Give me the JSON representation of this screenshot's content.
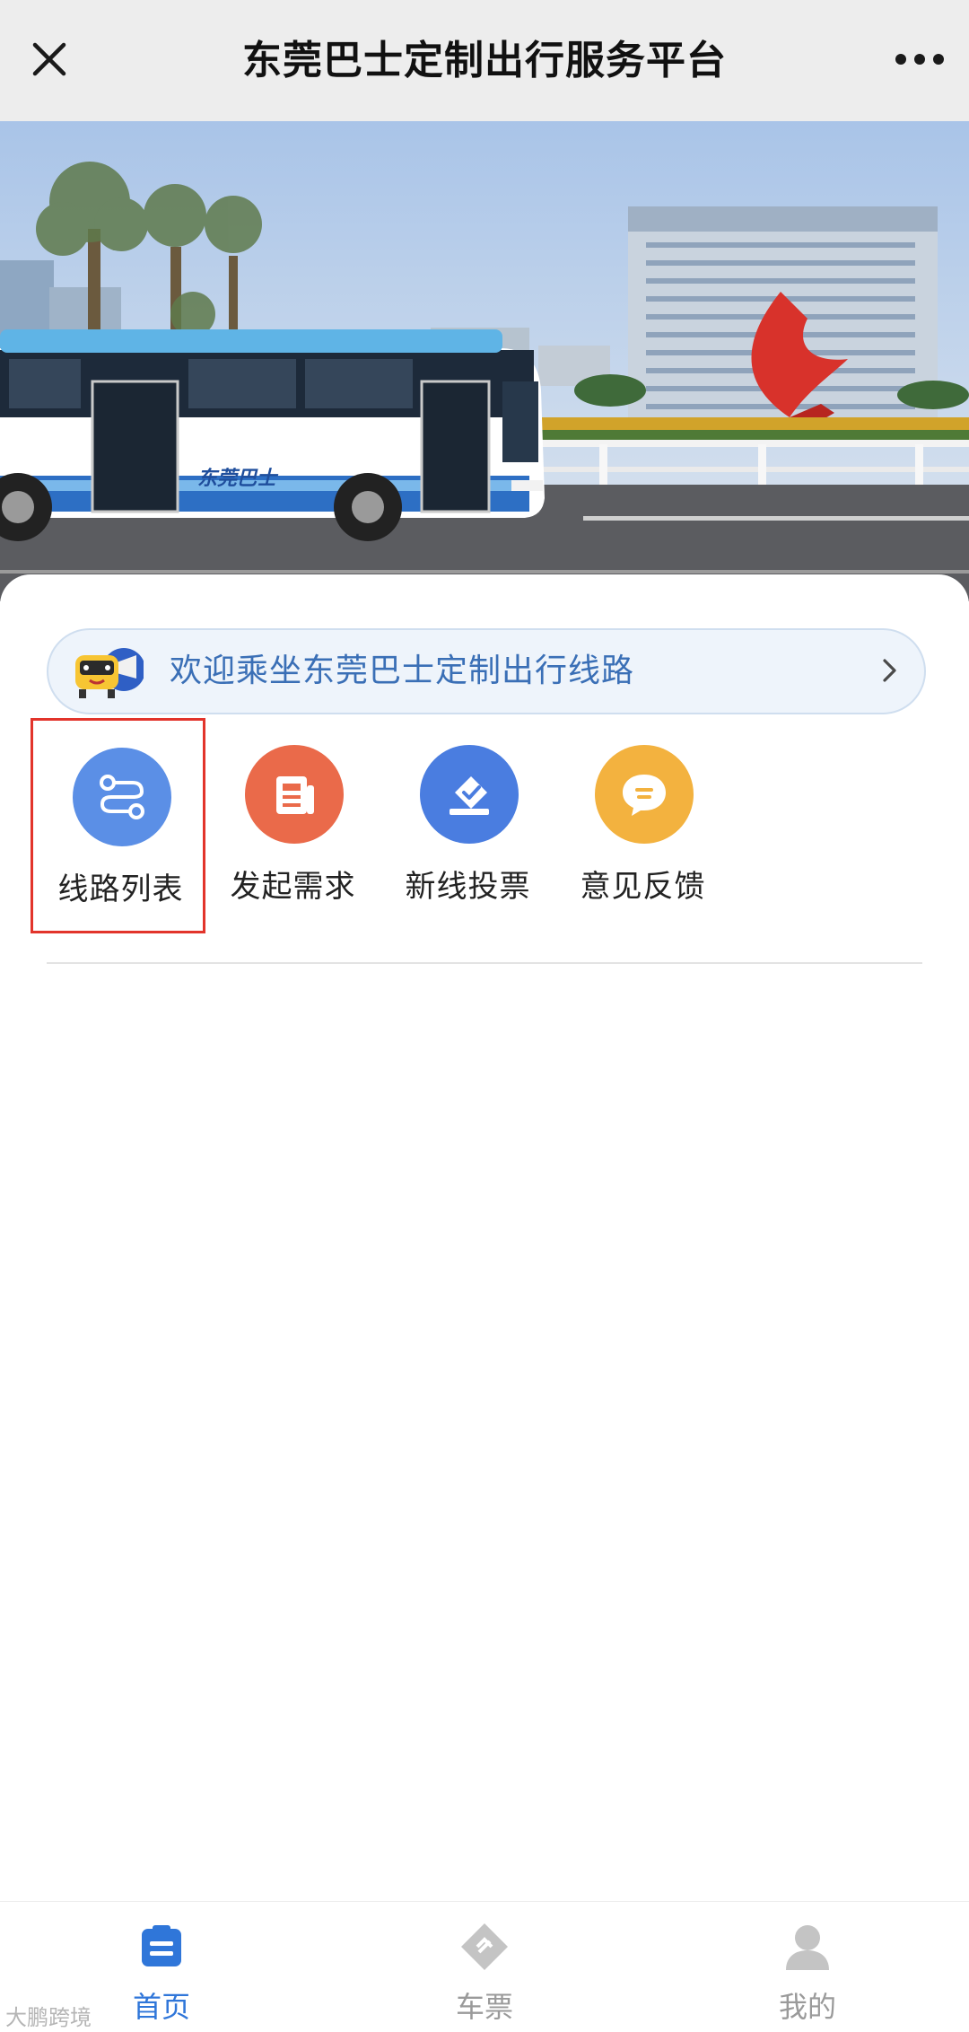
{
  "titlebar": {
    "title": "东莞巴士定制出行服务平台",
    "close_icon": "close-icon",
    "more_icon": "more-dots-icon"
  },
  "hero": {
    "bus_livery_text": "东莞巴士"
  },
  "notice": {
    "text": "欢迎乘坐东莞巴士定制出行线路",
    "icon": "bus-mascot-icon",
    "chevron": "chevron-right-icon"
  },
  "menu": {
    "items": [
      {
        "label": "线路列表",
        "icon": "route-icon",
        "color": "#5b8fe6"
      },
      {
        "label": "发起需求",
        "icon": "document-icon",
        "color": "#ea6a4a"
      },
      {
        "label": "新线投票",
        "icon": "vote-icon",
        "color": "#4a7de0"
      },
      {
        "label": "意见反馈",
        "icon": "feedback-icon",
        "color": "#f3b23f"
      }
    ]
  },
  "tabbar": {
    "tabs": [
      {
        "label": "首页",
        "icon": "home-list-icon",
        "active": true
      },
      {
        "label": "车票",
        "icon": "ticket-icon",
        "active": false
      },
      {
        "label": "我的",
        "icon": "user-icon",
        "active": false
      }
    ],
    "active_color": "#2f76d9",
    "inactive_color": "#9a9a9a"
  },
  "watermark": {
    "text": "大鹏跨境"
  }
}
